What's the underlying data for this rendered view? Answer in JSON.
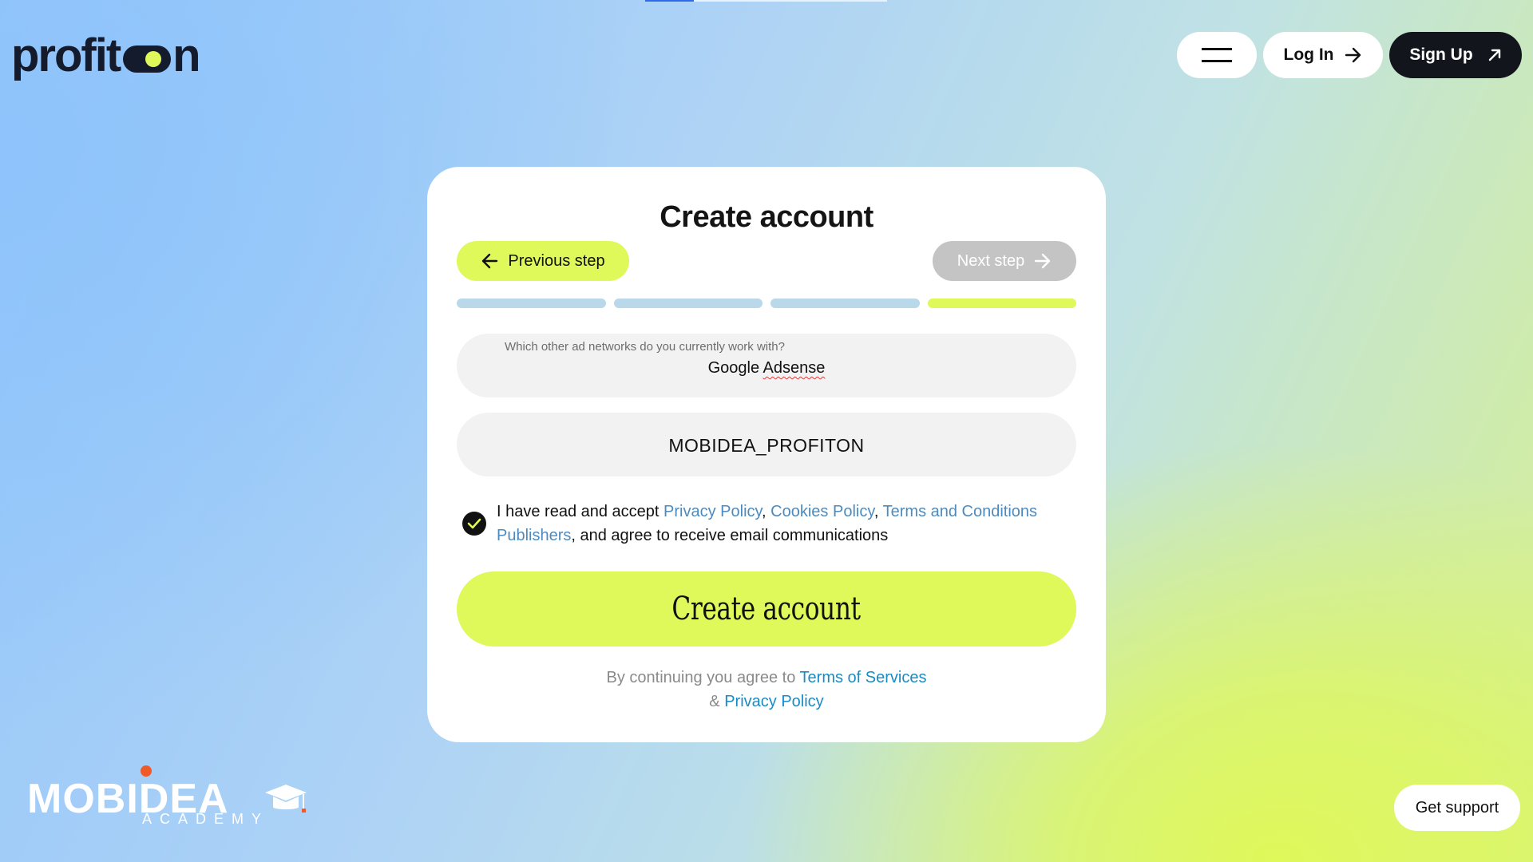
{
  "header": {
    "logo_text_left": "profit",
    "logo_text_right": "n",
    "menu_icon": "hamburger-icon",
    "login_label": "Log In",
    "login_icon": "arrow-right-icon",
    "signup_label": "Sign Up",
    "signup_icon": "arrow-up-right-icon"
  },
  "form": {
    "title": "Create account",
    "prev_label": "Previous step",
    "next_label": "Next step",
    "steps": {
      "total": 4,
      "current": 4
    },
    "ad_networks": {
      "label": "Which other ad networks do you currently work with?",
      "value_plain": "Google ",
      "value_flagged": "Adsense"
    },
    "promo_code": {
      "value": "MOBIDEA_PROFITON"
    },
    "consent": {
      "checked": true,
      "prefix": "I have read and accept ",
      "privacy": "Privacy Policy",
      "sep1": ", ",
      "cookies": "Cookies Policy",
      "sep2": ", ",
      "terms": "Terms and Conditions Publishers",
      "suffix": ", and agree to receive email communications"
    },
    "submit_label": "Create account",
    "agree": {
      "prefix": "By continuing you agree to ",
      "terms": "Terms of Services",
      "amp": "& ",
      "privacy": "Privacy Policy"
    }
  },
  "footer": {
    "brand_name": "MOBIDEA",
    "brand_sub": "ACADEMY",
    "support_label": "Get support"
  },
  "colors": {
    "accent": "#dff85a",
    "dark": "#12161c",
    "link": "#4d8bbf",
    "link_alt": "#1a8bc5",
    "disabled": "#c4c4c4",
    "progress_inactive": "#b9d8ea"
  }
}
